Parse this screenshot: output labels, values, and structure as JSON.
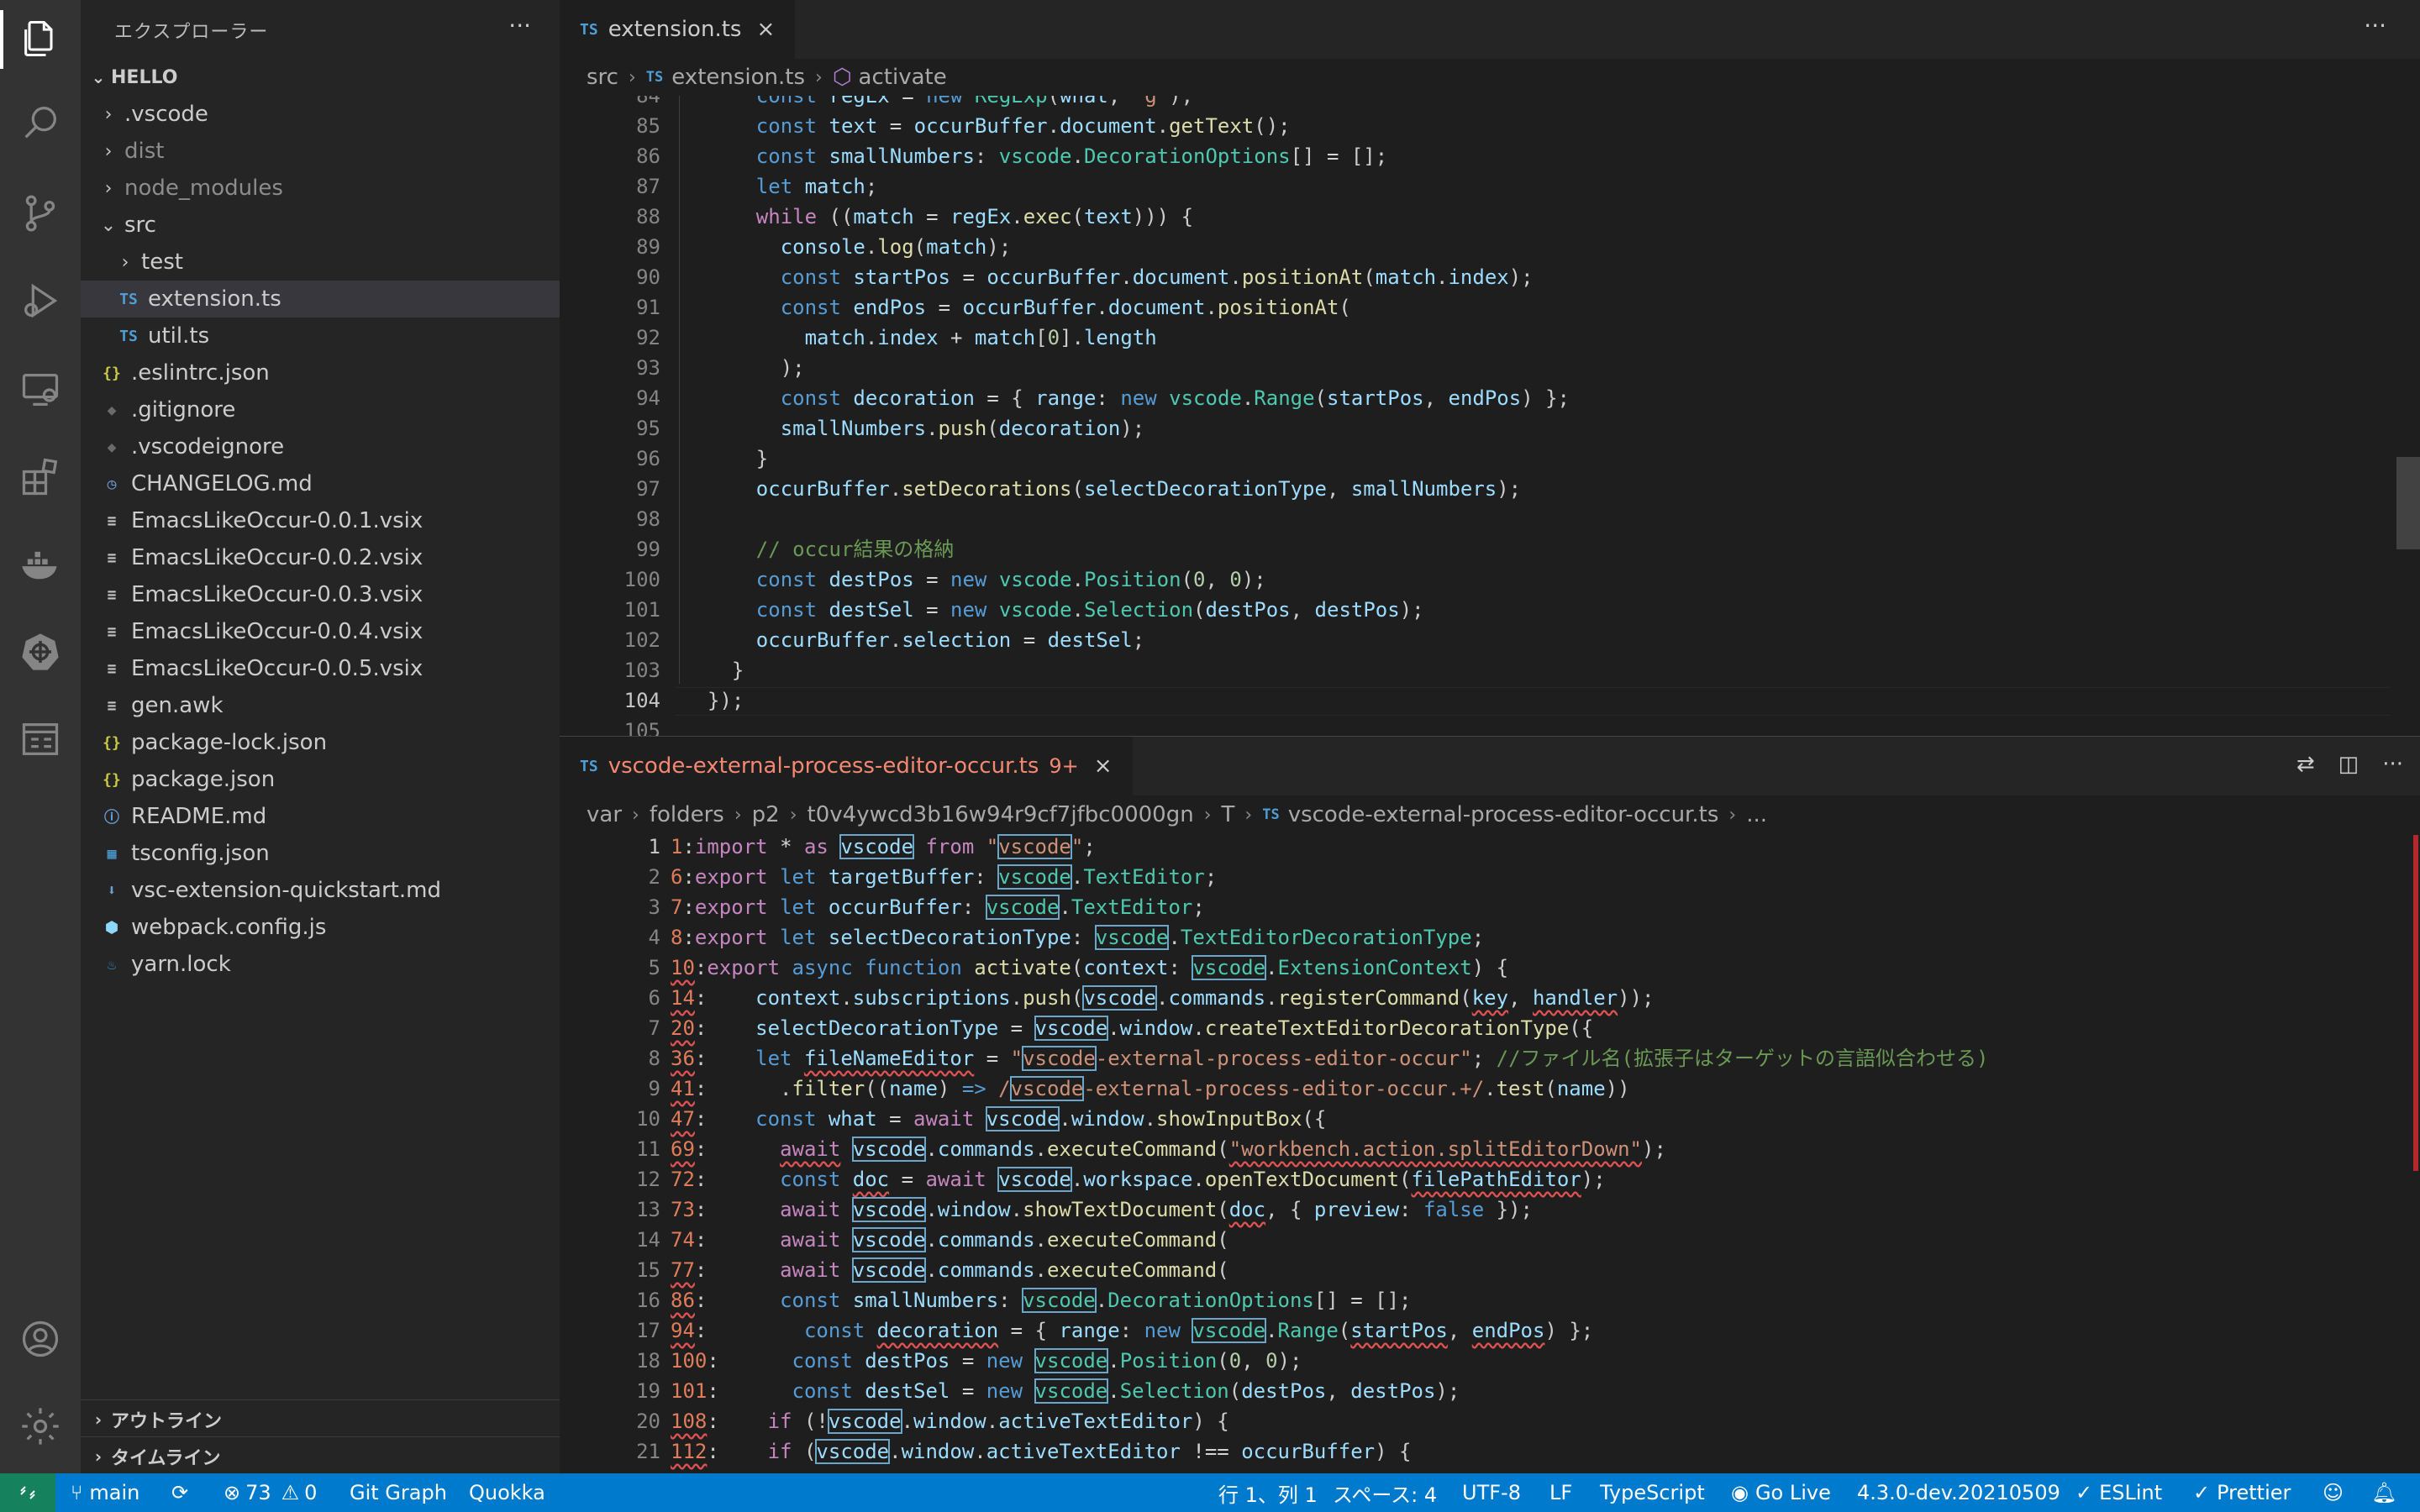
{
  "sidebar": {
    "title": "エクスプローラー",
    "more": "···",
    "root": "HELLO",
    "items": [
      {
        "label": ".vscode",
        "kind": "folder",
        "depth": 1,
        "icon": "folder-chevron-right-icon"
      },
      {
        "label": "dist",
        "kind": "folder",
        "depth": 1,
        "icon": "folder-chevron-right-icon",
        "dim": true
      },
      {
        "label": "node_modules",
        "kind": "folder",
        "depth": 1,
        "icon": "folder-chevron-right-icon",
        "dim": true
      },
      {
        "label": "src",
        "kind": "folder-open",
        "depth": 1,
        "icon": "folder-chevron-down-icon"
      },
      {
        "label": "test",
        "kind": "folder",
        "depth": 2,
        "icon": "folder-chevron-right-icon"
      },
      {
        "label": "extension.ts",
        "kind": "ts",
        "depth": 2,
        "icon": "typescript-file-icon",
        "selected": true
      },
      {
        "label": "util.ts",
        "kind": "ts",
        "depth": 2,
        "icon": "typescript-file-icon"
      },
      {
        "label": ".eslintrc.json",
        "kind": "json",
        "depth": 1,
        "icon": "json-file-icon"
      },
      {
        "label": ".gitignore",
        "kind": "git",
        "depth": 1,
        "icon": "git-file-icon"
      },
      {
        "label": ".vscodeignore",
        "kind": "git",
        "depth": 1,
        "icon": "ignore-file-icon"
      },
      {
        "label": "CHANGELOG.md",
        "kind": "changelog",
        "depth": 1,
        "icon": "changelog-file-icon"
      },
      {
        "label": "EmacsLikeOccur-0.0.1.vsix",
        "kind": "file",
        "depth": 1,
        "icon": "lines-file-icon"
      },
      {
        "label": "EmacsLikeOccur-0.0.2.vsix",
        "kind": "file",
        "depth": 1,
        "icon": "lines-file-icon"
      },
      {
        "label": "EmacsLikeOccur-0.0.3.vsix",
        "kind": "file",
        "depth": 1,
        "icon": "lines-file-icon"
      },
      {
        "label": "EmacsLikeOccur-0.0.4.vsix",
        "kind": "file",
        "depth": 1,
        "icon": "lines-file-icon"
      },
      {
        "label": "EmacsLikeOccur-0.0.5.vsix",
        "kind": "file",
        "depth": 1,
        "icon": "lines-file-icon"
      },
      {
        "label": "gen.awk",
        "kind": "file",
        "depth": 1,
        "icon": "lines-file-icon"
      },
      {
        "label": "package-lock.json",
        "kind": "json",
        "depth": 1,
        "icon": "json-file-icon"
      },
      {
        "label": "package.json",
        "kind": "json",
        "depth": 1,
        "icon": "json-file-icon"
      },
      {
        "label": "README.md",
        "kind": "info",
        "depth": 1,
        "icon": "info-file-icon"
      },
      {
        "label": "tsconfig.json",
        "kind": "tsconfig",
        "depth": 1,
        "icon": "tsconfig-file-icon"
      },
      {
        "label": "vsc-extension-quickstart.md",
        "kind": "md",
        "depth": 1,
        "icon": "markdown-file-icon"
      },
      {
        "label": "webpack.config.js",
        "kind": "webpack",
        "depth": 1,
        "icon": "webpack-file-icon"
      },
      {
        "label": "yarn.lock",
        "kind": "yarn",
        "depth": 1,
        "icon": "yarn-file-icon"
      }
    ],
    "outline": "アウトライン",
    "timeline": "タイムライン"
  },
  "editor1": {
    "tab_label": "extension.ts",
    "tab_lang": "TS",
    "more": "···",
    "breadcrumb": [
      "src",
      "extension.ts",
      "activate"
    ],
    "current_line": 104,
    "line_numbers": [
      84,
      85,
      86,
      87,
      88,
      89,
      90,
      91,
      92,
      93,
      94,
      95,
      96,
      97,
      98,
      99,
      100,
      101,
      102,
      103,
      104,
      105
    ]
  },
  "editor2": {
    "tab_label": "vscode-external-process-editor-occur.ts",
    "tab_lang": "TS",
    "badge": "9+",
    "breadcrumb": [
      "var",
      "folders",
      "p2",
      "t0v4ywcd3b16w94r9cf7jfbc0000gn",
      "T",
      "vscode-external-process-editor-occur.ts",
      "..."
    ],
    "line_numbers": [
      1,
      2,
      3,
      4,
      5,
      6,
      7,
      8,
      9,
      10,
      11,
      12,
      13,
      14,
      15,
      16,
      17,
      18,
      19,
      20,
      21
    ]
  },
  "status": {
    "branch": "main",
    "errors": "73",
    "warnings": "0",
    "git_graph": "Git Graph",
    "quokka": "Quokka",
    "position": "行 1、列 1",
    "spaces": "スペース: 4",
    "encoding": "UTF-8",
    "eol": "LF",
    "language": "TypeScript",
    "go_live": "Go Live",
    "version": "4.3.0-dev.20210509",
    "eslint": "ESLint",
    "prettier": "Prettier"
  }
}
